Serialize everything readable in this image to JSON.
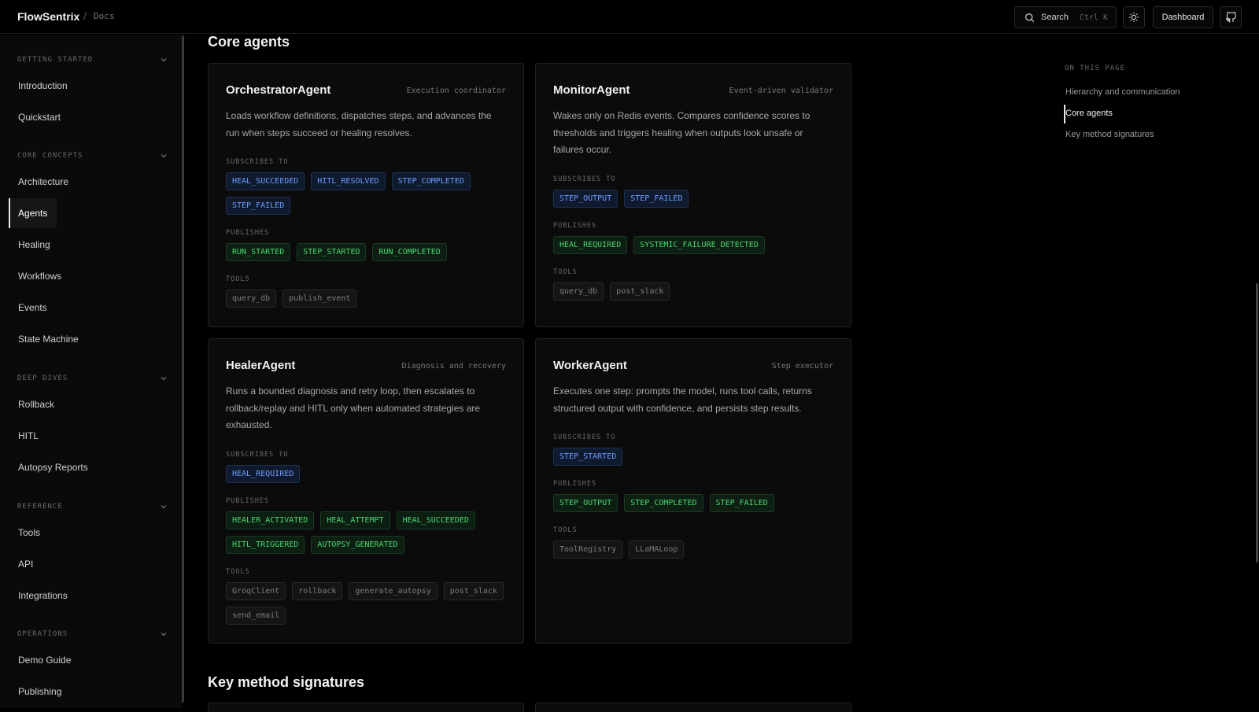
{
  "header": {
    "brand": "FlowSentrix",
    "separator": "/",
    "section": "Docs",
    "search_label": "Search",
    "search_shortcut": "Ctrl K",
    "dashboard_label": "Dashboard"
  },
  "sidebar": {
    "groups": [
      {
        "label": "GETTING STARTED",
        "items": [
          "Introduction",
          "Quickstart"
        ]
      },
      {
        "label": "CORE CONCEPTS",
        "items": [
          "Architecture",
          "Agents",
          "Healing",
          "Workflows",
          "Events",
          "State Machine"
        ]
      },
      {
        "label": "DEEP DIVES",
        "items": [
          "Rollback",
          "HITL",
          "Autopsy Reports"
        ]
      },
      {
        "label": "REFERENCE",
        "items": [
          "Tools",
          "API",
          "Integrations"
        ]
      },
      {
        "label": "OPERATIONS",
        "items": [
          "Demo Guide",
          "Publishing"
        ]
      }
    ],
    "active_item": "Agents"
  },
  "main": {
    "section_title": "Core agents",
    "next_section_title": "Key method signatures",
    "labels": {
      "subscribes": "SUBSCRIBES TO",
      "publishes": "PUBLISHES",
      "tools": "TOOLS"
    },
    "cards": [
      {
        "name": "OrchestratorAgent",
        "role": "Execution coordinator",
        "description": "Loads workflow definitions, dispatches steps, and advances the run when steps succeed or healing resolves.",
        "subscribes": [
          "HEAL_SUCCEEDED",
          "HITL_RESOLVED",
          "STEP_COMPLETED",
          "STEP_FAILED"
        ],
        "publishes": [
          "RUN_STARTED",
          "STEP_STARTED",
          "RUN_COMPLETED"
        ],
        "tools": [
          "query_db",
          "publish_event"
        ]
      },
      {
        "name": "MonitorAgent",
        "role": "Event-driven validator",
        "description": "Wakes only on Redis events. Compares confidence scores to thresholds and triggers healing when outputs look unsafe or failures occur.",
        "subscribes": [
          "STEP_OUTPUT",
          "STEP_FAILED"
        ],
        "publishes": [
          "HEAL_REQUIRED",
          "SYSTEMIC_FAILURE_DETECTED"
        ],
        "tools": [
          "query_db",
          "post_slack"
        ]
      },
      {
        "name": "HealerAgent",
        "role": "Diagnosis and recovery",
        "description": "Runs a bounded diagnosis and retry loop, then escalates to rollback/replay and HITL only when automated strategies are exhausted.",
        "subscribes": [
          "HEAL_REQUIRED"
        ],
        "publishes": [
          "HEALER_ACTIVATED",
          "HEAL_ATTEMPT",
          "HEAL_SUCCEEDED",
          "HITL_TRIGGERED",
          "AUTOPSY_GENERATED"
        ],
        "tools": [
          "GroqClient",
          "rollback",
          "generate_autopsy",
          "post_slack",
          "send_email"
        ]
      },
      {
        "name": "WorkerAgent",
        "role": "Step executor",
        "description": "Executes one step: prompts the model, runs tool calls, returns structured output with confidence, and persists step results.",
        "subscribes": [
          "STEP_STARTED"
        ],
        "publishes": [
          "STEP_OUTPUT",
          "STEP_COMPLETED",
          "STEP_FAILED"
        ],
        "tools": [
          "ToolRegistry",
          "LLaMALoop"
        ]
      }
    ]
  },
  "toc": {
    "label": "ON THIS PAGE",
    "items": [
      "Hierarchy and communication",
      "Core agents",
      "Key method signatures"
    ],
    "active": "Core agents"
  },
  "colors": {
    "subscribe": "#6f9dff",
    "publish": "#4cd870",
    "tool": "#7d7d7d"
  }
}
